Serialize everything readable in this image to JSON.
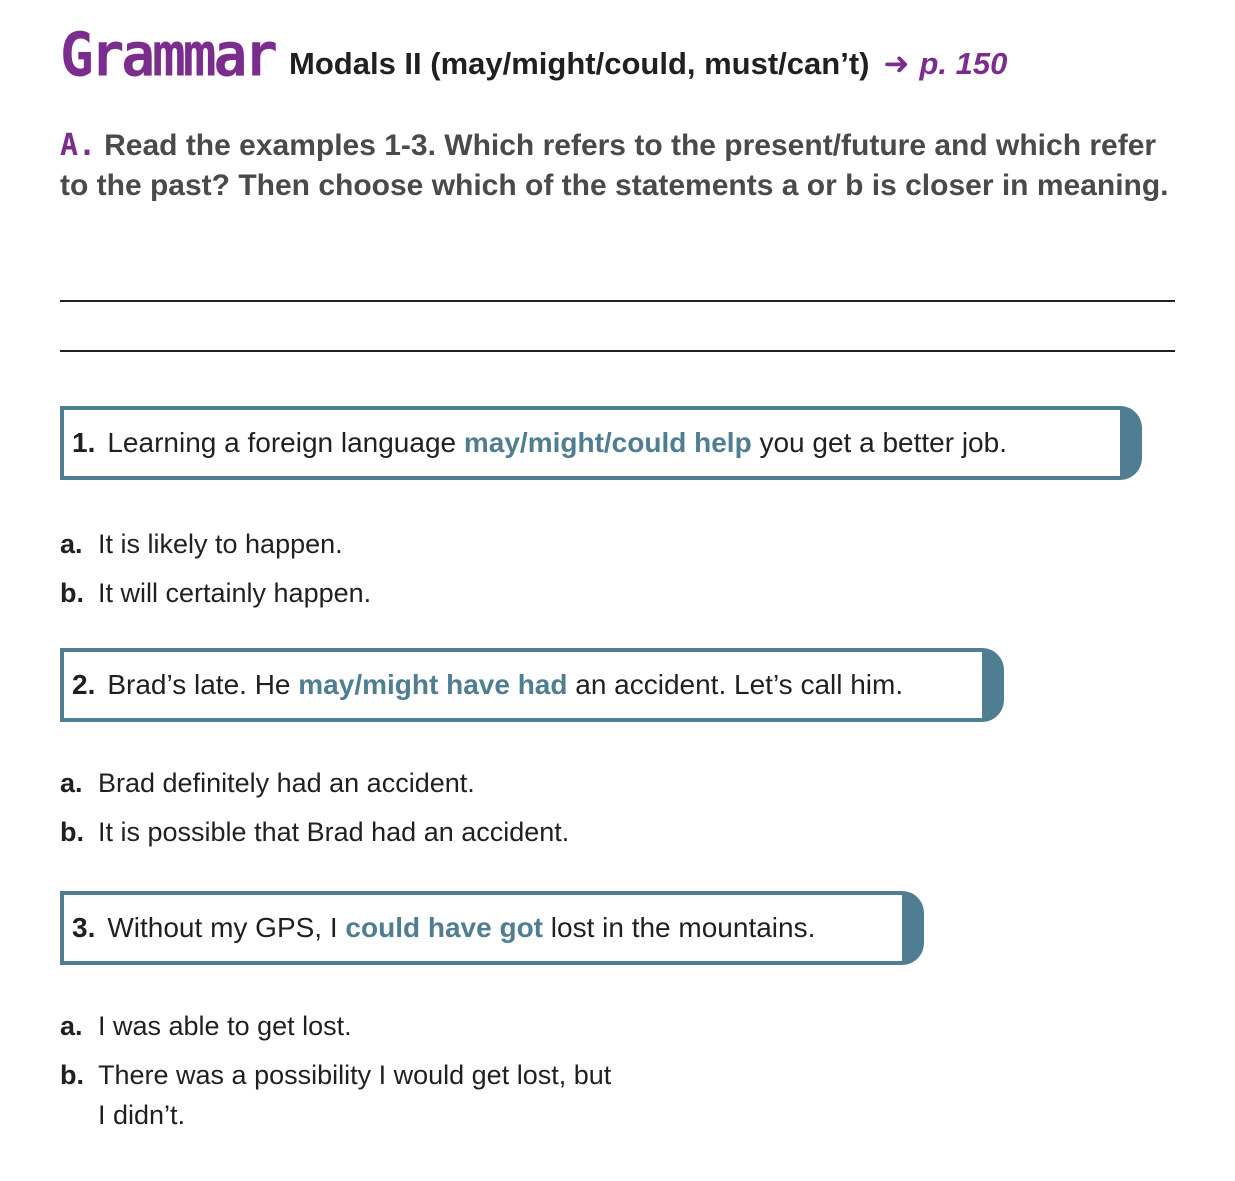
{
  "header": {
    "grammar_label": "Grammar",
    "title": "Modals II (may/might/could, must/can’t)",
    "arrow": "➜",
    "page_ref": "p. 150"
  },
  "instruction": {
    "letter": "A.",
    "text": "Read the examples 1-3. Which refers to the present/future and which refer to the past? Then choose which of the statements a or b is closer in meaning."
  },
  "colors": {
    "accent_purple": "#7b2d8e",
    "box_blue": "#4f7d92"
  },
  "examples": [
    {
      "number": "1.",
      "before": "Learning a foreign language ",
      "highlight": "may/might/could help",
      "after": " you get a better job.",
      "options": [
        {
          "letter": "a.",
          "text": "It is likely to happen."
        },
        {
          "letter": "b.",
          "text": "It will certainly happen."
        }
      ]
    },
    {
      "number": "2.",
      "before": "Brad’s late. He ",
      "highlight": "may/might have had",
      "after": " an accident. Let’s call him.",
      "options": [
        {
          "letter": "a.",
          "text": "Brad definitely had an accident."
        },
        {
          "letter": "b.",
          "text": "It is possible that Brad had an accident."
        }
      ]
    },
    {
      "number": "3.",
      "before": "Without my GPS, I ",
      "highlight": "could have got",
      "after": " lost in the mountains.",
      "options": [
        {
          "letter": "a.",
          "text": "I was able to get lost."
        },
        {
          "letter": "b.",
          "text": "There was a possibility I would get lost, but",
          "text_cont": "I didn’t."
        }
      ]
    }
  ]
}
